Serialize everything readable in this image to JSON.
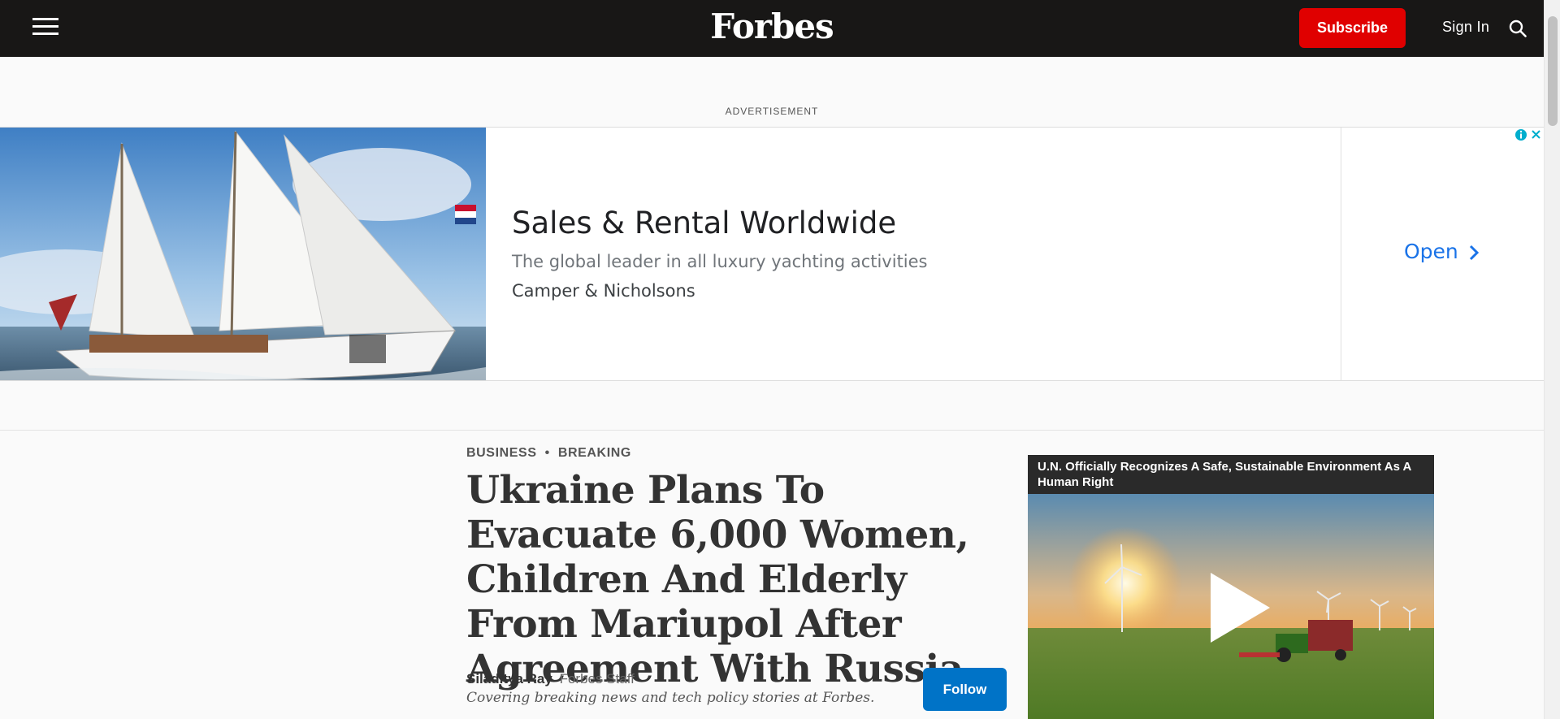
{
  "nav": {
    "logo": "Forbes",
    "subscribe_label": "Subscribe",
    "signin_label": "Sign In"
  },
  "ad": {
    "label": "ADVERTISEMENT",
    "title": "Sales & Rental Worldwide",
    "description": "The global leader in all luxury yachting activities",
    "brand": "Camper & Nicholsons",
    "cta": "Open"
  },
  "article": {
    "categories": [
      "BUSINESS",
      "BREAKING"
    ],
    "headline": "Ukraine Plans To Evacuate 6,000 Women, Children And Elderly From Mariupol After Agreement With Russia",
    "author_name": "Siladitya Ray",
    "author_role": "Forbes Staff",
    "author_bio": "Covering breaking news and tech policy stories at Forbes.",
    "follow_label": "Follow"
  },
  "video": {
    "title": "U.N. Officially Recognizes A Safe, Sustainable Environment As A Human Right"
  },
  "colors": {
    "nav_bg": "#181716",
    "subscribe_bg": "#e00000",
    "follow_bg": "#0073c7",
    "ad_link": "#1a73e8"
  },
  "icons": [
    "hamburger-menu-icon",
    "search-icon",
    "chevron-right-icon",
    "adchoices-info-icon",
    "ad-close-icon",
    "play-icon"
  ]
}
